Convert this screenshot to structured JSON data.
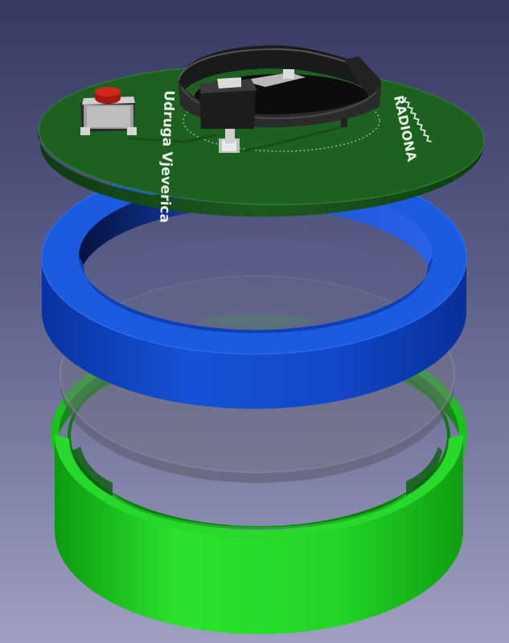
{
  "scene": {
    "pcb_label_left": "Udruga Vjeverica",
    "pcb_label_right": "RADIONA",
    "colors": {
      "background_top": "#373964",
      "background_bottom": "#9fa0c2",
      "pcb": "#1d5e1f",
      "pcb_edge": "#0f3c11",
      "blue_ring": "#1147c8",
      "green_ring": "#22d425",
      "transparent_disc": "#6f6f7d",
      "battery_holder": "#1a1a1a",
      "button_cap": "#b81d12"
    },
    "components": [
      "pcb-board",
      "push-button",
      "coin-cell-holder",
      "blue-ring",
      "transparent-disc",
      "green-ring"
    ]
  }
}
